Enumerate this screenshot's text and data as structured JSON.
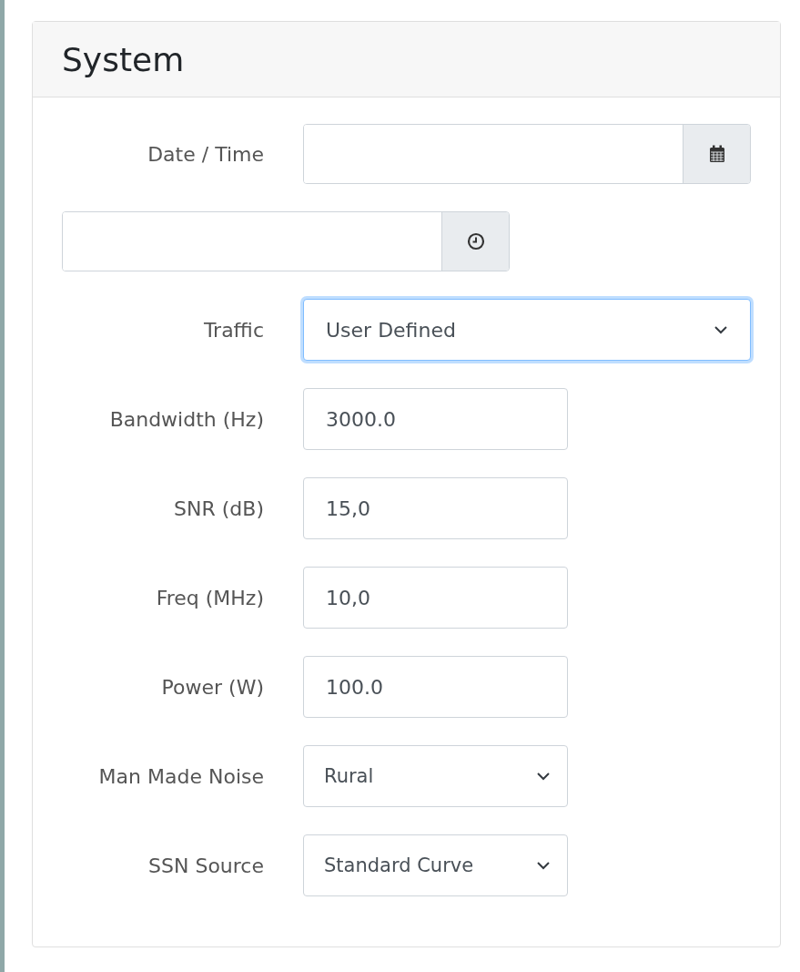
{
  "panel": {
    "title": "System"
  },
  "fields": [
    {
      "kind": "date",
      "label": "Date / Time"
    },
    {
      "kind": "time"
    },
    {
      "kind": "wide-select",
      "label": "Traffic",
      "value": "User Defined",
      "focused": true
    },
    {
      "kind": "number",
      "label": "Bandwidth (Hz)",
      "value": "3000.0"
    },
    {
      "kind": "number",
      "label": "SNR (dB)",
      "value": "15,0"
    },
    {
      "kind": "number",
      "label": "Freq (MHz)",
      "value": "10,0"
    },
    {
      "kind": "number",
      "label": "Power (W)",
      "value": "100.0"
    },
    {
      "kind": "select",
      "label": "Man Made Noise",
      "value": "Rural",
      "focused": false
    },
    {
      "kind": "select",
      "label": "SSN Source",
      "value": "Standard Curve",
      "focused": false
    }
  ]
}
